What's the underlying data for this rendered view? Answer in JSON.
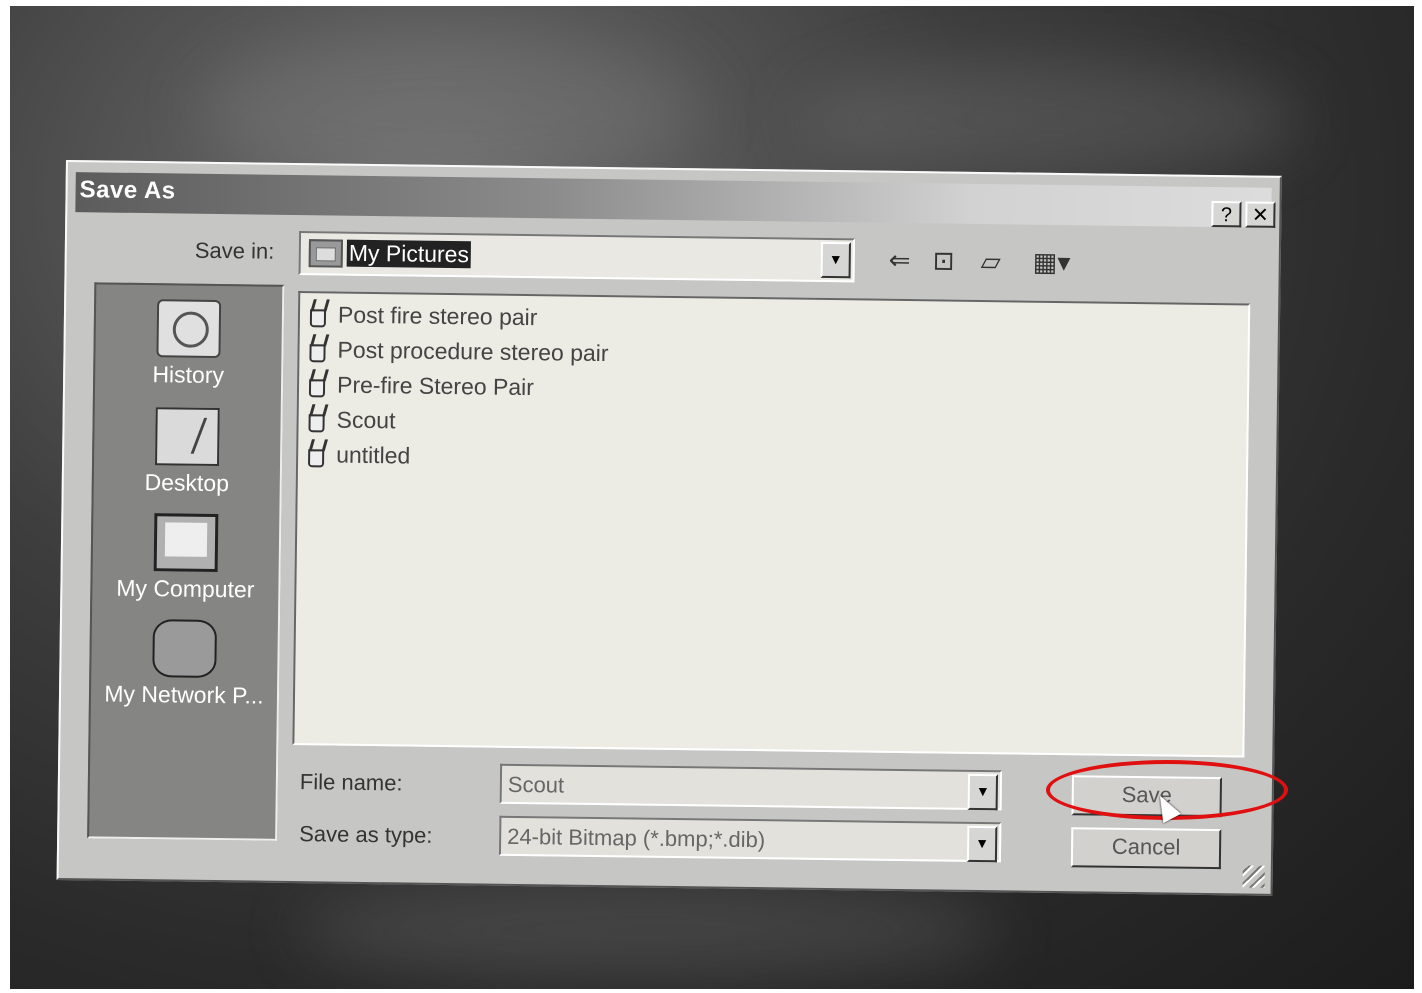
{
  "window": {
    "title": "Save As",
    "help_label": "?",
    "close_label": "✕"
  },
  "save_in": {
    "label": "Save in:",
    "value": "My Pictures"
  },
  "toolbar": {
    "back_icon": "back-arrow-icon",
    "up_icon": "up-folder-icon",
    "new_folder_icon": "new-folder-icon",
    "view_icon": "view-menu-icon"
  },
  "places": [
    {
      "label": "History",
      "icon": "history-icon"
    },
    {
      "label": "Desktop",
      "icon": "desktop-icon"
    },
    {
      "label": "My Computer",
      "icon": "my-computer-icon"
    },
    {
      "label": "My Network P...",
      "icon": "network-places-icon"
    }
  ],
  "files": [
    {
      "name": "Post fire stereo pair"
    },
    {
      "name": "Post procedure stereo pair"
    },
    {
      "name": "Pre-fire Stereo Pair"
    },
    {
      "name": "Scout"
    },
    {
      "name": "untitled"
    }
  ],
  "file_name": {
    "label": "File name:",
    "value": "Scout"
  },
  "save_as_type": {
    "label": "Save as type:",
    "value": "24-bit Bitmap (*.bmp;*.dib)"
  },
  "buttons": {
    "save": "Save",
    "cancel": "Cancel"
  },
  "annotation": {
    "color": "#e01010"
  }
}
